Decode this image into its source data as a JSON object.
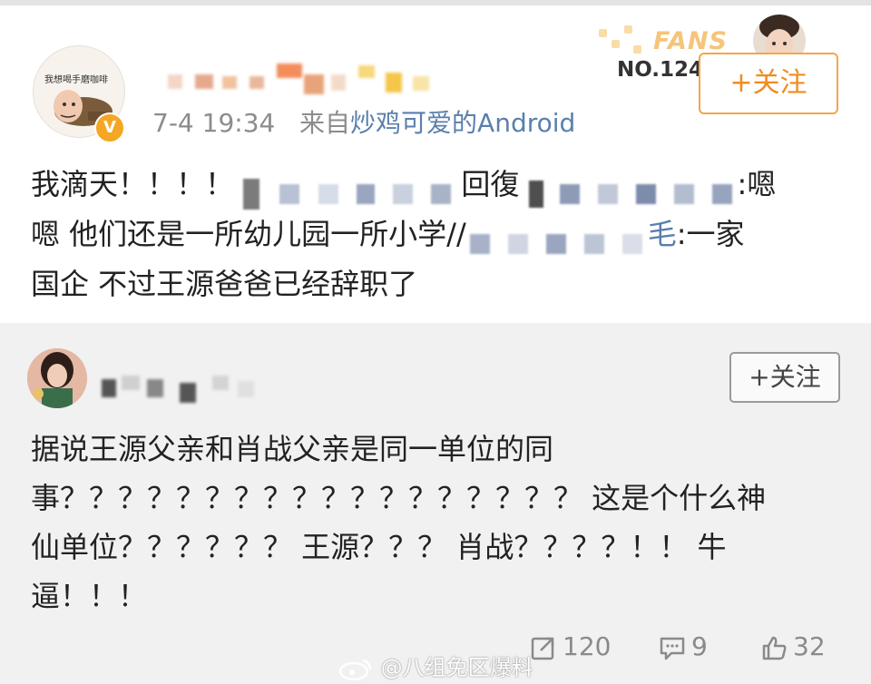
{
  "post1": {
    "avatar_caption": "我想喝手磨咖啡",
    "verified_badge": "V",
    "timestamp": "7-4 19:34",
    "source_prefix": "来自",
    "source_name": "炒鸡可爱的Android",
    "fans_badge_text": "FANS",
    "fans_number": "NO.1247",
    "follow_label": "+关注",
    "body_line1_a": "我滴天！！！！",
    "body_line1_b": "回復",
    "body_line1_c": ":嗯",
    "body_line2_a": "嗯 他们还是一所幼儿园一所小学//",
    "body_line2_b": "毛",
    "body_line2_c": ":一家",
    "body_line3": "国企 不过王源爸爸已经辞职了"
  },
  "post2": {
    "follow_label": "+关注",
    "body_lines": [
      "据说王源父亲和肖战父亲是同一单位的同",
      "事？？？？？？？？？？？？？？？？？？ 这是个什么神",
      "仙单位？？？？？？ 王源？？？ 肖战？？？？！！ 牛",
      "逼！！！"
    ],
    "repost_count": "120",
    "comment_count": "9",
    "like_count": "32"
  },
  "watermark": "@八组免区爆料",
  "icons": {
    "repost": "repost-icon",
    "comment": "comment-icon",
    "like": "like-icon",
    "weibo": "weibo-logo-icon"
  },
  "colors": {
    "link_blue": "#5a7fae",
    "follow_orange": "#f08c1e",
    "verified_gold": "#f5a623"
  }
}
